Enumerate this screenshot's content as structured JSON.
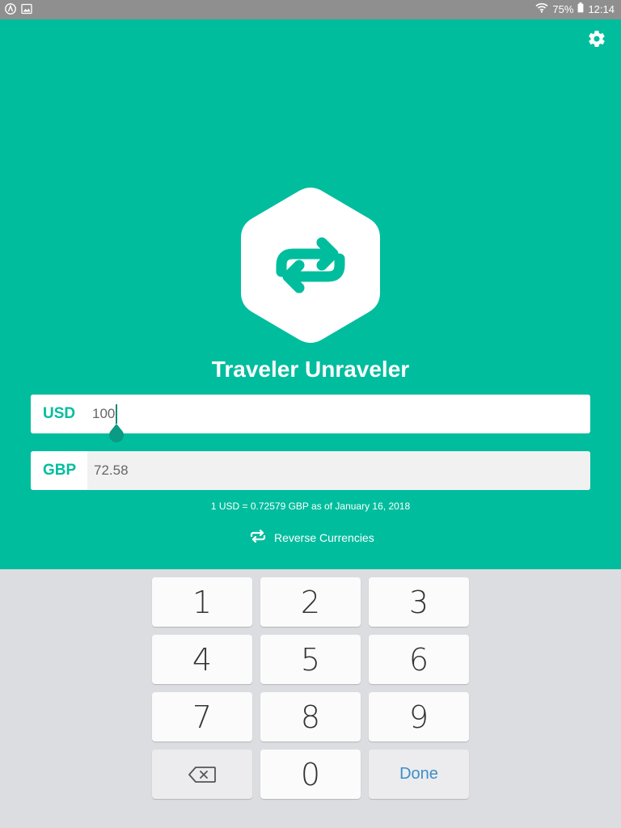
{
  "status_bar": {
    "battery": "75%",
    "time": "12:14",
    "icons": [
      "android-a-icon",
      "image-icon",
      "wifi-icon",
      "battery-icon"
    ]
  },
  "app": {
    "title": "Traveler Unraveler",
    "accent_color": "#00bd9e",
    "settings_icon": "gear-icon",
    "logo_icon": "swap-arrows-icon"
  },
  "converter": {
    "from": {
      "code": "USD",
      "value": "100"
    },
    "to": {
      "code": "GBP",
      "value": "72.58"
    },
    "rate_text": "1 USD = 0.72579 GBP as of January 16, 2018",
    "reverse_label": "Reverse Currencies"
  },
  "keypad": {
    "keys": [
      "1",
      "2",
      "3",
      "4",
      "5",
      "6",
      "7",
      "8",
      "9",
      "",
      "0",
      "Done"
    ],
    "backspace_icon": "backspace-icon",
    "done_color": "#3d8ec7"
  }
}
